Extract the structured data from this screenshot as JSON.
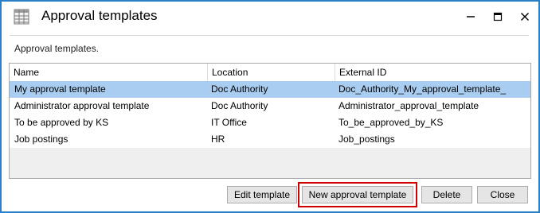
{
  "window": {
    "title": "Approval templates",
    "icon": "table-grid-icon",
    "controls": [
      "minimize-icon",
      "maximize-icon",
      "close-icon"
    ]
  },
  "subtitle": "Approval templates.",
  "table": {
    "headers": [
      "Name",
      "Location",
      "External ID"
    ],
    "rows": [
      {
        "name": "My approval template",
        "location": "Doc Authority",
        "external_id": "Doc_Authority_My_approval_template_",
        "selected": true
      },
      {
        "name": "Administrator approval template",
        "location": "Doc Authority",
        "external_id": "Administrator_approval_template",
        "selected": false
      },
      {
        "name": "To be approved by KS",
        "location": "IT Office",
        "external_id": "To_be_approved_by_KS",
        "selected": false
      },
      {
        "name": "Job postings",
        "location": "HR",
        "external_id": "Job_postings",
        "selected": false
      }
    ]
  },
  "buttons": {
    "edit": "Edit template",
    "new": "New approval template",
    "delete": "Delete",
    "close": "Close"
  },
  "colors": {
    "window_border": "#2b7fc7",
    "selection": "#a9cdf0",
    "highlight": "#d00000"
  }
}
